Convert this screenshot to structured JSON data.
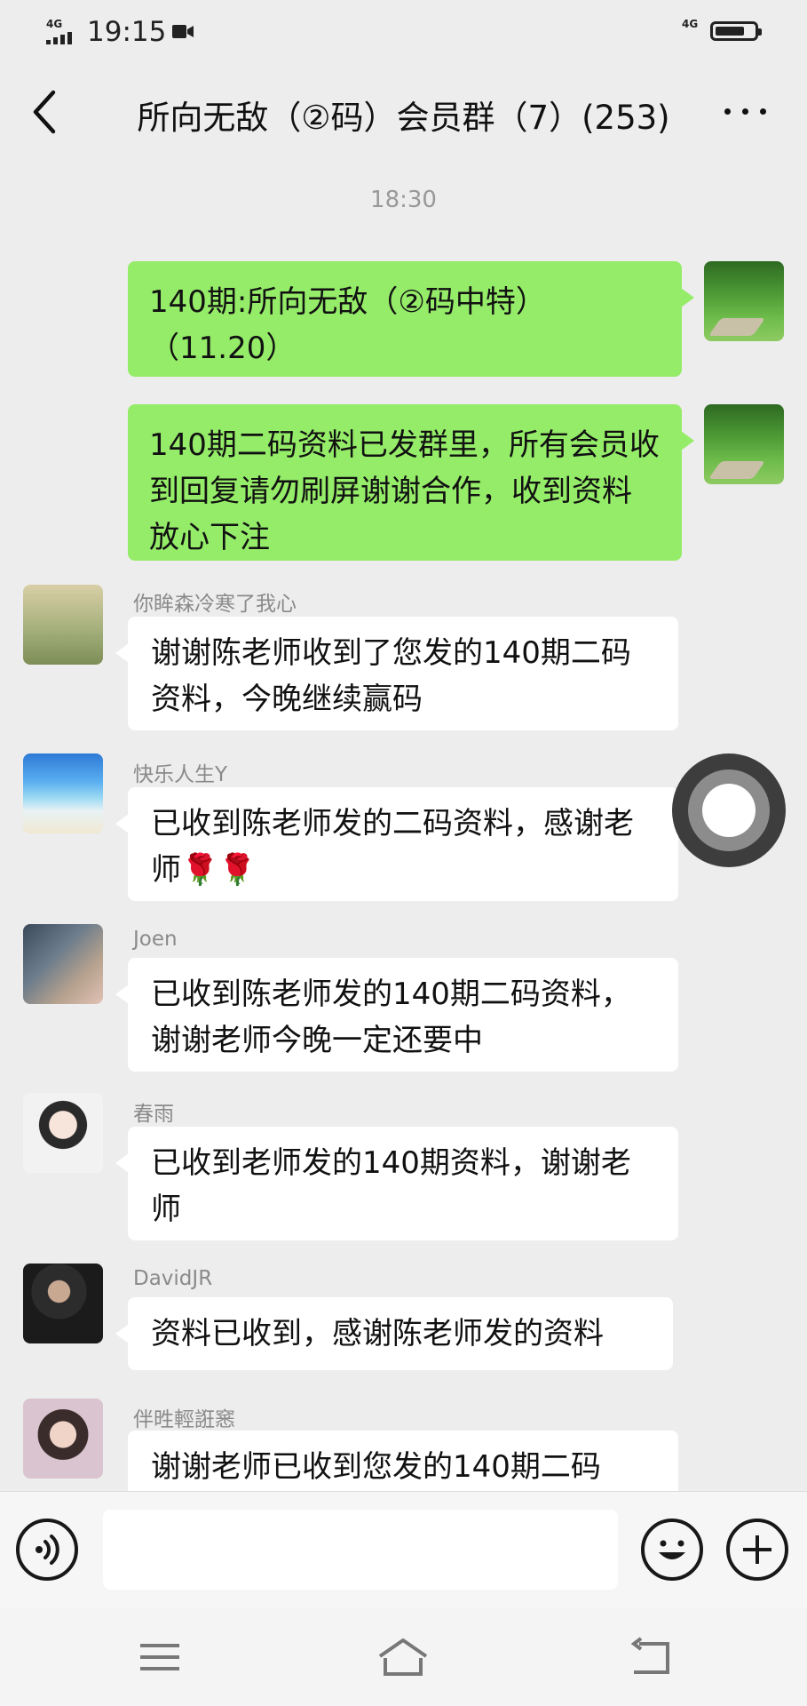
{
  "status_bar": {
    "network": "4G",
    "network_right": "4G",
    "time": "19:15"
  },
  "header": {
    "title": "所向无敌（②码）会员群（7）(253)"
  },
  "chat": {
    "timestamp": "18:30",
    "messages": [
      {
        "direction": "out",
        "sender": "",
        "avatar": "garden-avatar",
        "text": "140期:所向无敌（②码中特）（11.20）"
      },
      {
        "direction": "out",
        "sender": "",
        "avatar": "garden-avatar",
        "text": "140期二码资料已发群里，所有会员收到回复请勿刷屏谢谢合作，收到资料放心下注"
      },
      {
        "direction": "in",
        "sender": "你眸森冷寒了我心",
        "avatar": "two-girls-avatar",
        "text": "谢谢陈老师收到了您发的140期二码资料，今晚继续赢码"
      },
      {
        "direction": "in",
        "sender": "快乐人生Y",
        "avatar": "beach-avatar",
        "text": "已收到陈老师发的二码资料，感谢老师🌹🌹"
      },
      {
        "direction": "in",
        "sender": "Joen",
        "avatar": "joen-avatar",
        "text": "已收到陈老师发的140期二码资料，谢谢老师今晚一定还要中"
      },
      {
        "direction": "in",
        "sender": "春雨",
        "avatar": "chunyu-avatar",
        "text": "已收到老师发的140期资料，谢谢老师"
      },
      {
        "direction": "in",
        "sender": "DavidJR",
        "avatar": "davidjr-avatar",
        "text": "资料已收到，感谢陈老师发的资料"
      },
      {
        "direction": "in",
        "sender": "伴甠輕誑窸",
        "avatar": "ban-avatar",
        "text": "谢谢老师已收到您发的140期二码"
      }
    ]
  },
  "input": {
    "value": "",
    "placeholder": ""
  },
  "icons": {
    "back": "chevron-left-icon",
    "more": "more-dots-icon",
    "voice": "voice-icon",
    "emoji": "emoji-icon",
    "plus": "plus-icon",
    "menu": "menu-icon",
    "home": "home-icon",
    "back_nav": "return-icon",
    "float": "floating-ball-icon"
  },
  "colors": {
    "outgoing_bubble": "#95ec69",
    "incoming_bubble": "#ffffff",
    "background": "#ededed"
  }
}
